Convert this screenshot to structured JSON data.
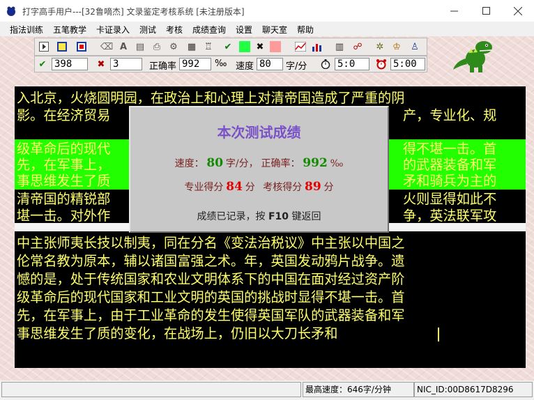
{
  "window": {
    "title": "打字高手用户---[32鲁嘀杰]    文录鉴定考核系统  [未注册版本]"
  },
  "menu": [
    "指法训练",
    "五笔教学",
    "卡证录入",
    "测试",
    "考核",
    "成绩查询",
    "设置",
    "聊天室",
    "帮助"
  ],
  "toolbar": {
    "correct_count": "398",
    "error_count": "3",
    "accuracy_label": "正确率",
    "accuracy_value": "992",
    "accuracy_unit": "‰",
    "speed_label": "速度",
    "speed_value": "80",
    "speed_unit": "字/分",
    "elapsed_time": "5:0",
    "alarm_time": "5:00"
  },
  "colors": {
    "good_swatch": "#22ff44",
    "bad_swatch": "#ff9a9a",
    "text_yellow": "#ffff6a",
    "highlight_green": "#22ff00"
  },
  "editor": {
    "ref_line1": "入北京，火烧圆明园，在政治上和心理上对清帝国造成了严重的阴",
    "ref_line2_a": "影。在经济贸易",
    "ref_line2_b": "产，专业化、规",
    "ref_line3_a": "级革命后的现代",
    "ref_line3_b": "得不堪一击。首",
    "ref_line4_a": "先，在军事上，",
    "ref_line4_b": "的武器装备和军",
    "ref_line5_a": "事思维发生了质",
    "ref_line5_b": "矛和骑兵为主的",
    "ref_line6_a": "清帝国的精锐部",
    "ref_line6_b": "火则显得如此不",
    "ref_line7_a": "堪一击。对外作",
    "ref_line7_b": "争，英法联军攻",
    "typed_line1": "中主张师夷长技以制夷，同在分名《变法治税议》中主张以中国之",
    "typed_line2": "伦常名教为原本，辅以诸国富强之术。年，英国发动鸦片战争。遗",
    "typed_line3": "憾的是，处于传统国家和农业文明体系下的中国在面对经过资产阶",
    "typed_line4": "级革命后的现代国家和工业文明的英国的挑战时显得不堪一击。首",
    "typed_line5": "先，在军事上，由于工业革命的发生使得英国军队的武器装备和军",
    "typed_line6": "事思维发生了质的变化，在战场上，仍旧以大刀长矛和"
  },
  "dialog": {
    "title": "本次测试成绩",
    "speed_label": "速度：",
    "speed_value": "80",
    "speed_unit": "字/分，",
    "accuracy_label": "正确率：",
    "accuracy_value": "992",
    "accuracy_unit": "‰",
    "pro_score_label": "专业得分",
    "pro_score_value": "84",
    "pro_score_unit": "分",
    "exam_score_label": "考核得分",
    "exam_score_value": "89",
    "exam_score_unit": "分",
    "footer_prefix": "成绩已记录，按",
    "footer_key": "F10",
    "footer_suffix": "键返回"
  },
  "statusbar": {
    "max_speed": "最高速度：646字/分钟",
    "nic_id": "NIC_ID:00D8617D8296"
  }
}
